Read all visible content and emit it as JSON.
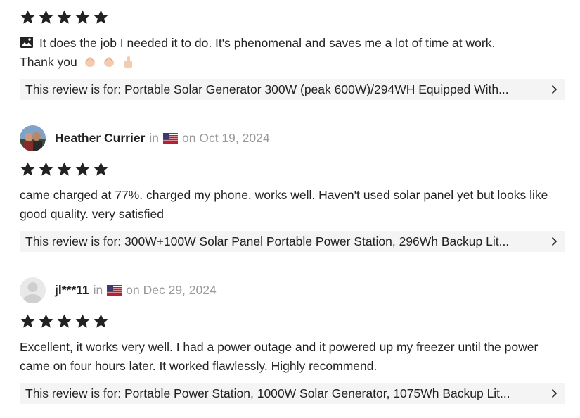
{
  "reviews": [
    {
      "rating": 5,
      "text_line1": "It does the job I needed it to do. It's phenomenal and saves me a lot of time at work.",
      "text_line2": "Thank you",
      "review_for": "This review is for: Portable Solar Generator 300W (peak 600W)/294WH Equipped With..."
    },
    {
      "author": "Heather Currier",
      "in_label": "in",
      "date": "on Oct 19, 2024",
      "rating": 5,
      "text": "came charged at 77%. charged my phone. works well. Haven't used solar panel yet but looks like good quality. very satisfied",
      "review_for": "This review is for: 300W+100W Solar Panel Portable Power Station, 296Wh Backup Lit..."
    },
    {
      "author": "jl***11",
      "in_label": "in",
      "date": "on Dec 29, 2024",
      "rating": 5,
      "text": "Excellent, it works very well. I had a power outage and it powered up my freezer until the power came on four hours later. It worked flawlessly. Highly recommend.",
      "review_for": "This review is for: Portable Power Station, 1000W Solar Generator, 1075Wh Backup Lit..."
    }
  ],
  "icons": {
    "star": "star-icon",
    "image": "image-icon",
    "flag": "us-flag-icon",
    "chevron": "chevron-right-icon",
    "clap": "clapping-hands-icon",
    "thumb": "thumbs-up-icon"
  },
  "colors": {
    "star": "#222222",
    "muted": "#999999",
    "review_for_bg": "#f4f4f4"
  }
}
